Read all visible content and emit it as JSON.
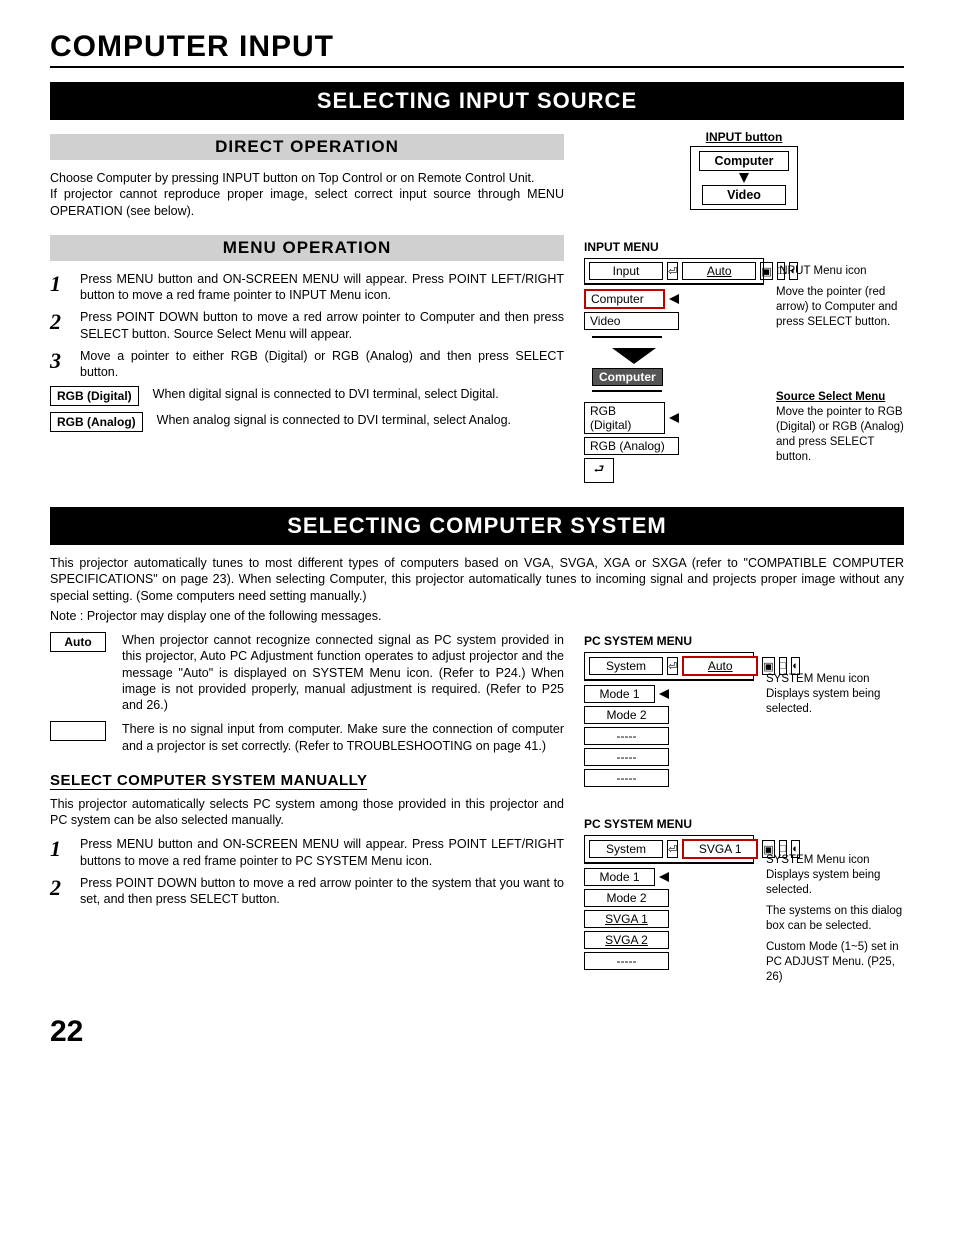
{
  "page_title": "COMPUTER INPUT",
  "banner1": "SELECTING INPUT SOURCE",
  "direct_op_heading": "DIRECT OPERATION",
  "direct_op_para1": "Choose Computer by pressing INPUT button on Top Control or on Remote Control Unit.",
  "direct_op_para2": "If projector cannot reproduce proper image, select correct input source through MENU OPERATION (see below).",
  "menu_op_heading": "MENU OPERATION",
  "step1": "Press MENU button and ON-SCREEN MENU will appear.  Press POINT LEFT/RIGHT button to move a red frame pointer to INPUT Menu icon.",
  "step2": "Press POINT DOWN button to move a red arrow pointer to Computer and then press SELECT button.  Source Select Menu will appear.",
  "step3": "Move a pointer to either RGB (Digital) or RGB (Analog) and then press SELECT button.",
  "rgb_digital_label": "RGB (Digital)",
  "rgb_digital_text": "When digital signal is connected to DVI terminal, select Digital.",
  "rgb_analog_label": "RGB (Analog)",
  "rgb_analog_text": "When analog signal is connected to DVI terminal, select Analog.",
  "input_button_label": "INPUT button",
  "ib_computer": "Computer",
  "ib_video": "Video",
  "input_menu_label": "INPUT MENU",
  "im_input": "Input",
  "im_auto": "Auto",
  "im_computer": "Computer",
  "im_video": "Video",
  "im_computer_pill": "Computer",
  "im_rgb_digital": "RGB (Digital)",
  "im_rgb_analog": "RGB (Analog)",
  "im_note1": "INPUT Menu icon",
  "im_note2": "Move the pointer (red arrow) to Computer and press SELECT button.",
  "im_note3_title": "Source Select Menu",
  "im_note3_body": "Move the pointer to RGB (Digital) or RGB (Analog) and press SELECT button.",
  "banner2": "SELECTING COMPUTER SYSTEM",
  "sys_para": "This projector automatically tunes to most different types of computers based on VGA, SVGA, XGA or SXGA (refer to \"COMPATIBLE COMPUTER SPECIFICATIONS\" on page 23).  When selecting Computer, this projector automatically tunes to incoming signal and projects proper image without any special setting.  (Some computers need setting manually.)",
  "sys_note": "Note : Projector may display one of the following messages.",
  "auto_label": "Auto",
  "auto_text": "When projector cannot recognize connected signal as PC system provided in this projector, Auto PC Adjustment function operates to adjust projector and the message \"Auto\" is displayed on SYSTEM Menu icon.  (Refer to P24.)  When image is not provided properly, manual adjustment is required.  (Refer to P25 and 26.)",
  "blank_text": "There is no signal input from computer.  Make sure the connection of computer and a projector is set correctly.  (Refer to TROUBLESHOOTING on page 41.)",
  "manual_heading": "SELECT COMPUTER SYSTEM MANUALLY",
  "manual_para": "This projector automatically selects PC system among those provided in this projector and PC system can be also selected manually.",
  "mstep1": "Press MENU button and ON-SCREEN MENU will appear.  Press POINT LEFT/RIGHT buttons to move a red frame pointer to PC SYSTEM Menu icon.",
  "mstep2": "Press POINT DOWN button to move a red arrow pointer to the system that you want to set, and then press SELECT button.",
  "pcmenu_label": "PC SYSTEM MENU",
  "pc_system": "System",
  "pc_auto": "Auto",
  "pc_mode1": "Mode 1",
  "pc_mode2": "Mode 2",
  "pc_dash": "-----",
  "pc_note1": "SYSTEM Menu icon\nDisplays system being selected.",
  "pc_svga1": "SVGA 1",
  "pc_svga2": "SVGA 2",
  "pc2_note1": "SYSTEM Menu icon\nDisplays system being selected.",
  "pc2_note2": "The systems on this dialog box can be selected.",
  "pc2_note3": "Custom Mode (1~5) set in PC ADJUST Menu.  (P25, 26)",
  "page_number": "22"
}
